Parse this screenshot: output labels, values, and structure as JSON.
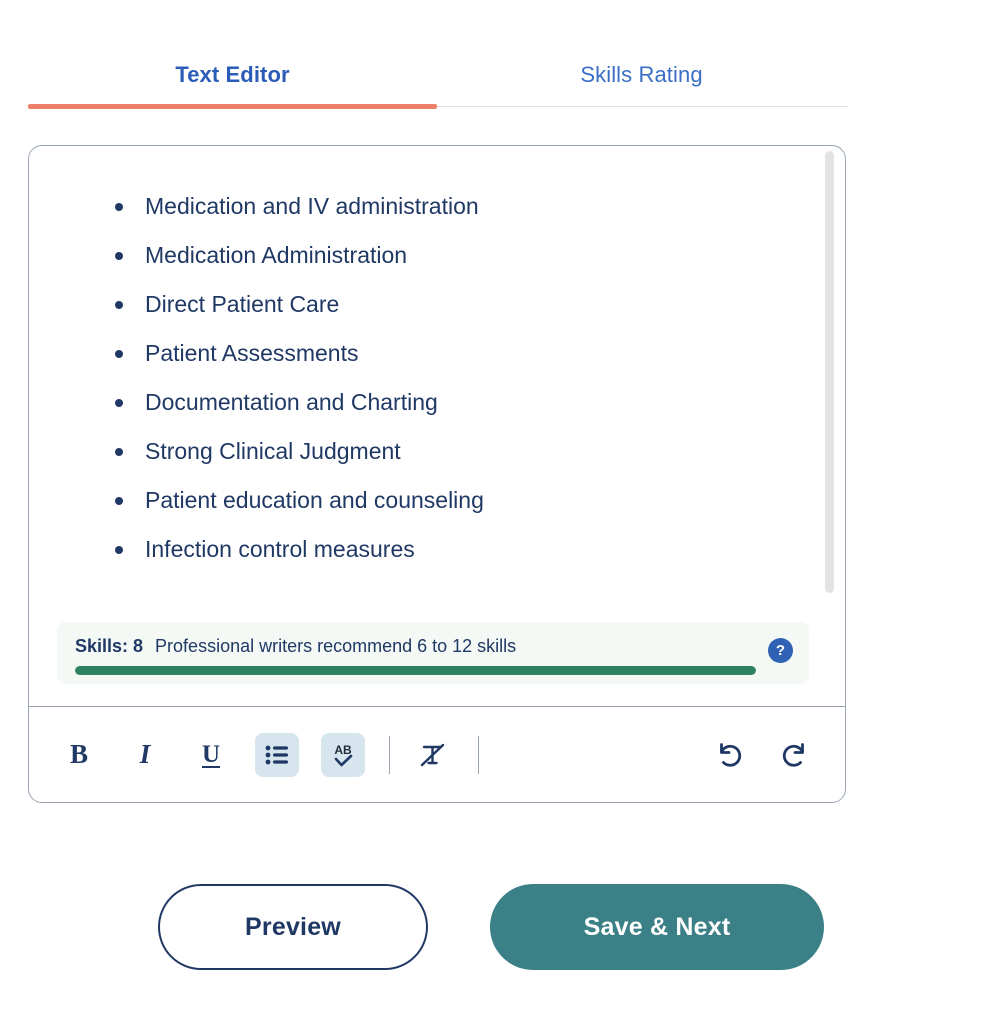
{
  "tabs": [
    {
      "label": "Text Editor",
      "active": true,
      "name": "tab-text-editor"
    },
    {
      "label": "Skills Rating",
      "active": false,
      "name": "tab-skills-rating"
    }
  ],
  "editor": {
    "skills": [
      "Medication and IV administration",
      "Medication Administration",
      "Direct Patient Care",
      "Patient Assessments",
      "Documentation and Charting",
      "Strong Clinical Judgment",
      "Patient education and counseling",
      "Infection control measures"
    ],
    "meter": {
      "count_label": "Skills: 8",
      "hint": "Professional writers recommend 6 to 12 skills",
      "help_icon": "?",
      "progress_percent": 100,
      "fill_color": "#2f8261",
      "background_color": "#f4f9f6"
    },
    "toolbar": [
      {
        "name": "bold-icon",
        "glyph": "B",
        "style": "b",
        "active": false
      },
      {
        "name": "italic-icon",
        "glyph": "I",
        "style": "i",
        "active": false
      },
      {
        "name": "underline-icon",
        "glyph": "U",
        "style": "u",
        "active": false
      },
      {
        "name": "bullet-list-icon",
        "glyph": "",
        "style": "svg-list",
        "active": true
      },
      {
        "name": "spellcheck-icon",
        "glyph": "AB",
        "style": "svg-spell",
        "active": true
      },
      {
        "name": "divider",
        "glyph": "",
        "style": "divider",
        "active": false
      },
      {
        "name": "clear-formatting-icon",
        "glyph": "",
        "style": "svg-clear",
        "active": false
      },
      {
        "name": "divider",
        "glyph": "",
        "style": "divider",
        "active": false
      },
      {
        "name": "undo-icon",
        "glyph": "",
        "style": "svg-undo",
        "active": false
      },
      {
        "name": "redo-icon",
        "glyph": "",
        "style": "svg-redo",
        "active": false
      }
    ]
  },
  "actions": {
    "preview_label": "Preview",
    "save_label": "Save & Next"
  },
  "colors": {
    "tab_active": "#2b5cb8",
    "tab_inactive": "#3a6fc4",
    "tab_underline": "#ed8068",
    "text_navy": "#1f3864",
    "save_teal": "#3b7f87",
    "help_blue": "#2f62b4",
    "toolbar_active_bg": "#d6e5ee"
  }
}
